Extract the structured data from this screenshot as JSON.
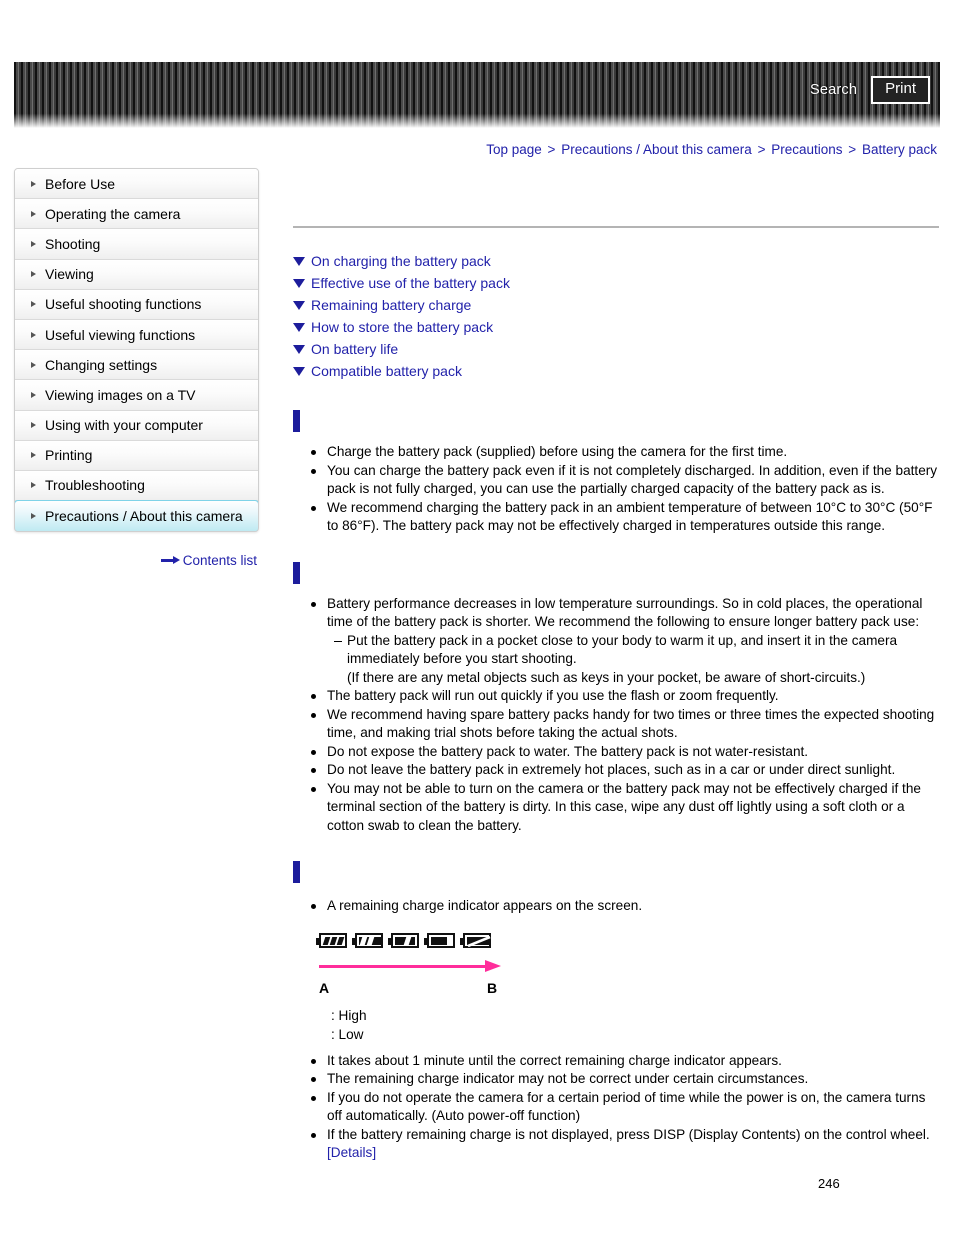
{
  "header": {
    "search_label": "Search",
    "print_label": "Print"
  },
  "breadcrumb": {
    "separator": ">",
    "items": [
      "Top page",
      "Precautions / About this camera",
      "Precautions",
      "Battery pack"
    ]
  },
  "sidebar": {
    "items": [
      {
        "label": "Before Use"
      },
      {
        "label": "Operating the camera"
      },
      {
        "label": "Shooting"
      },
      {
        "label": "Viewing"
      },
      {
        "label": "Useful shooting functions"
      },
      {
        "label": "Useful viewing functions"
      },
      {
        "label": "Changing settings"
      },
      {
        "label": "Viewing images on a TV"
      },
      {
        "label": "Using with your computer"
      },
      {
        "label": "Printing"
      },
      {
        "label": "Troubleshooting"
      },
      {
        "label": "Precautions / About this camera"
      }
    ],
    "contents_list_label": "Contents list"
  },
  "main": {
    "page_title": "",
    "anchors": [
      "On charging the battery pack",
      "Effective use of the battery pack",
      "Remaining battery charge",
      "How to store the battery pack",
      "On battery life",
      "Compatible battery pack"
    ],
    "sections": [
      {
        "heading": "",
        "bullets": [
          {
            "type": "bullet",
            "text": "Charge the battery pack (supplied) before using the camera for the first time."
          },
          {
            "type": "bullet",
            "text": "You can charge the battery pack even if it is not completely discharged. In addition, even if the battery pack is not fully charged, you can use the partially charged capacity of the battery pack as is."
          },
          {
            "type": "bullet",
            "text": "We recommend charging the battery pack in an ambient temperature of between 10°C to 30°C (50°F to 86°F). The battery pack may not be effectively charged in temperatures outside this range."
          }
        ]
      },
      {
        "heading": "",
        "bullets": [
          {
            "type": "bullet",
            "text": "Battery performance decreases in low temperature surroundings. So in cold places, the operational time of the battery pack is shorter. We recommend the following to ensure longer battery pack use:"
          },
          {
            "type": "dash",
            "text": "Put the battery pack in a pocket close to your body to warm it up, and insert it in the camera immediately before you start shooting."
          },
          {
            "type": "plain",
            "text": "(If there are any metal objects such as keys in your pocket, be aware of short-circuits.)"
          },
          {
            "type": "bullet",
            "text": "The battery pack will run out quickly if you use the flash or zoom frequently."
          },
          {
            "type": "bullet",
            "text": "We recommend having spare battery packs handy for two times or three times the expected shooting time, and making trial shots before taking the actual shots."
          },
          {
            "type": "bullet",
            "text": "Do not expose the battery pack to water. The battery pack is not water-resistant."
          },
          {
            "type": "bullet",
            "text": "Do not leave the battery pack in extremely hot places, such as in a car or under direct sunlight."
          },
          {
            "type": "bullet",
            "text": "You may not be able to turn on the camera or the battery pack may not be effectively charged if the terminal section of the battery is dirty. In this case, wipe any dust off lightly using a soft cloth or a cotton swab to clean the battery."
          }
        ]
      },
      {
        "heading": "",
        "intro_bullet": "A remaining charge indicator appears on the screen.",
        "figure": {
          "left_marker": "A",
          "right_marker": "B",
          "legend_high": ": High",
          "legend_low": ": Low",
          "arrow_color": "#ff2d9b"
        },
        "bullets": [
          {
            "type": "bullet",
            "text": "It takes about 1 minute until the correct remaining charge indicator appears."
          },
          {
            "type": "bullet",
            "text": "The remaining charge indicator may not be correct under certain circumstances."
          },
          {
            "type": "bullet",
            "text": "If you do not operate the camera for a certain period of time while the power is on, the camera turns off automatically. (Auto power-off function)"
          },
          {
            "type": "bullet",
            "text": "If the battery remaining charge is not displayed, press DISP (Display Contents) on the control wheel."
          }
        ],
        "details_link": "[Details]"
      }
    ]
  },
  "footer": {
    "page_number": "246"
  },
  "colors": {
    "link": "#2222aa",
    "section_bar": "#1d1d9c",
    "active_nav": "#bfeaf2",
    "arrow_magenta": "#ff2d9b"
  }
}
